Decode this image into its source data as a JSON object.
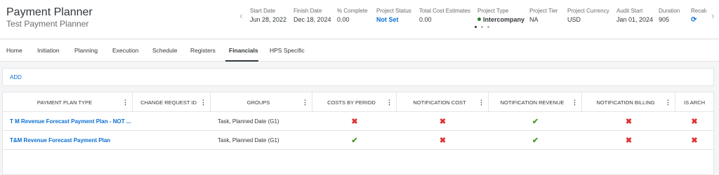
{
  "header": {
    "title": "Payment Planner",
    "subtitle": "Test Payment Planner",
    "kpis": [
      {
        "label": "Start Date",
        "value": "Jun 28, 2022"
      },
      {
        "label": "Finish Date",
        "value": "Dec 18, 2024"
      },
      {
        "label": "% Complete",
        "value": "0.00"
      },
      {
        "label": "Project Status",
        "value": "Not Set"
      },
      {
        "label": "Total Cost Estimates",
        "value": "0.00"
      },
      {
        "label": "Project Type",
        "value": "Intercompany"
      },
      {
        "label": "Project Tier",
        "value": "NA"
      },
      {
        "label": "Project Currency",
        "value": "USD"
      },
      {
        "label": "Audit Start",
        "value": "Jan 01, 2024"
      },
      {
        "label": "Duration",
        "value": "905"
      },
      {
        "label": "Recalc",
        "value": "⟳"
      }
    ],
    "prev_arrow": "‹",
    "next_arrow": "›"
  },
  "tabs": [
    "Home",
    "Initiation",
    "Planning",
    "Execution",
    "Schedule",
    "Registers",
    "Financials",
    "HPS Specific"
  ],
  "active_tab": "Financials",
  "toolbar": {
    "add_label": "ADD"
  },
  "table": {
    "columns": [
      "PAYMENT PLAN TYPE",
      "CHANGE REQUEST ID",
      "GROUPS",
      "COSTS BY PERIOD",
      "NOTIFICATION COST",
      "NOTIFICATION REVENUE",
      "NOTIFICATION BILLING",
      "IS ARCH"
    ],
    "rows": [
      {
        "payment_plan_type": "T M Revenue Forecast Payment Plan - NOT ...",
        "change_request_id": "",
        "groups": "Task, Planned Date (G1)",
        "costs_by_period": false,
        "notification_cost": false,
        "notification_revenue": true,
        "notification_billing": false,
        "is_arch": false
      },
      {
        "payment_plan_type": "T&M Revenue Forecast Payment Plan",
        "change_request_id": "",
        "groups": "Task, Planned Date (G1)",
        "costs_by_period": true,
        "notification_cost": false,
        "notification_revenue": true,
        "notification_billing": false,
        "is_arch": false
      }
    ],
    "check_glyph": "✔",
    "cross_glyph": "✖",
    "kebab_glyph": "⋮"
  },
  "colors": {
    "accent": "#0a6ed1",
    "check": "#4b9a2b",
    "cross": "#e03131"
  }
}
